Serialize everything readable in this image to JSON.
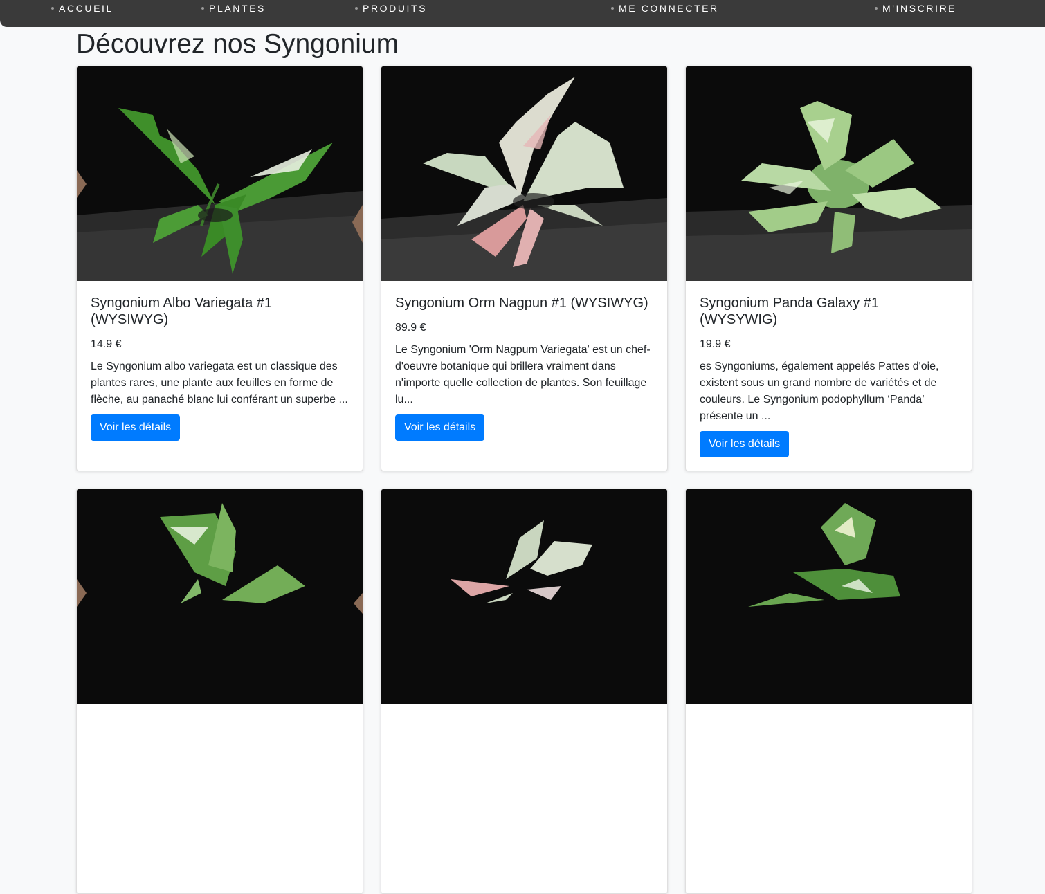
{
  "nav": {
    "items": [
      "ACCUEIL",
      "PLANTES",
      "PRODUITS",
      "ME CONNECTER",
      "M'INSCRIRE"
    ]
  },
  "page": {
    "title": "Découvrez nos Syngonium"
  },
  "colors": {
    "navbar": "#3a3a3a",
    "button": "#007bff",
    "background": "#f8f9fa",
    "photo_bg": "#0b0b0b"
  },
  "products": [
    {
      "title": "Syngonium Albo Variegata #1 (WYSIWYG)",
      "price": "14.9 €",
      "description": "Le Syngonium albo variegata est un classique des plantes rares, une plante aux feuilles en forme de flèche, au panaché blanc lui conférant un superbe ...",
      "button": "Voir les détails",
      "image": "plant-photo-albo-variegata"
    },
    {
      "title": "Syngonium Orm Nagpun #1 (WYSIWYG)",
      "price": "89.9 €",
      "description": "Le Syngonium 'Orm Nagpum Variegata' est un chef-d'oeuvre botanique qui brillera vraiment dans n'importe quelle collection de plantes. Son feuillage lu...",
      "button": "Voir les détails",
      "image": "plant-photo-orm-nagpun"
    },
    {
      "title": "Syngonium Panda Galaxy #1 (WYSYWIG)",
      "price": "19.9 €",
      "description": "es Syngoniums, également appelés Pattes d'oie, existent sous un grand nombre de variétés et de couleurs. Le Syngonium podophyllum ‘Panda’ présente un ...",
      "button": "Voir les détails",
      "image": "plant-photo-panda-galaxy"
    },
    {
      "image": "plant-photo-4"
    },
    {
      "image": "plant-photo-5"
    },
    {
      "image": "plant-photo-6"
    }
  ]
}
